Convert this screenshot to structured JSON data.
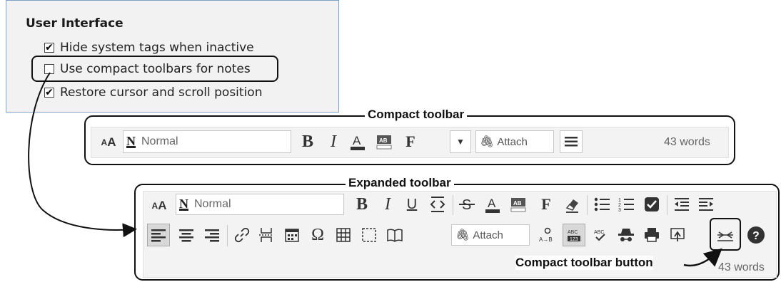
{
  "settings": {
    "title": "User Interface",
    "options": [
      {
        "label": "Hide system tags when inactive",
        "checked": true
      },
      {
        "label": "Use compact toolbars for notes",
        "checked": false
      },
      {
        "label": "Restore cursor and scroll position",
        "checked": true
      }
    ]
  },
  "compact_toolbar": {
    "caption": "Compact toolbar",
    "font_size_label": "AA",
    "style_value": "Normal",
    "style_icon_letter": "N",
    "bold_label": "B",
    "italic_label": "I",
    "font_label": "F",
    "attach_label": "Attach",
    "word_count": "43 words"
  },
  "expanded_toolbar": {
    "caption": "Expanded toolbar",
    "font_size_label": "AA",
    "style_value": "Normal",
    "style_icon_letter": "N",
    "bold_label": "B",
    "italic_label": "I",
    "underline_label": "U",
    "font_label": "F",
    "omega_label": "Ω",
    "attach_label": "Attach",
    "word_count": "43 words"
  },
  "callout": {
    "compact_button_label": "Compact toolbar button"
  },
  "colors": {
    "panel_border": "#7fa3c8",
    "panel_background": "#f2f2f2",
    "toolbar_background": "#f3f3f3",
    "outline": "#111111"
  }
}
